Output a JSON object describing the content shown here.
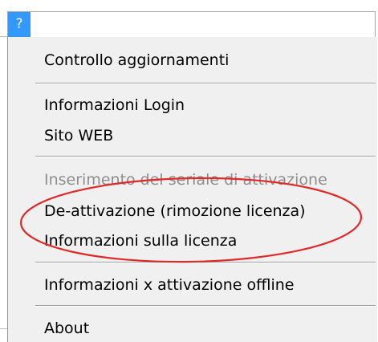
{
  "menubar": {
    "help_label": "?"
  },
  "menu": {
    "items": [
      {
        "label": "Controllo aggiornamenti",
        "enabled": true
      },
      {
        "label": "Informazioni Login",
        "enabled": true
      },
      {
        "label": "Sito WEB",
        "enabled": true
      },
      {
        "label": "Inserimento del seriale di attivazione",
        "enabled": false
      },
      {
        "label": "De-attivazione (rimozione licenza)",
        "enabled": true
      },
      {
        "label": "Informazioni sulla licenza",
        "enabled": true
      },
      {
        "label": "Informazioni x attivazione offline",
        "enabled": true
      },
      {
        "label": "About",
        "enabled": true
      }
    ]
  },
  "annotation": {
    "color": "#e02a2a"
  }
}
